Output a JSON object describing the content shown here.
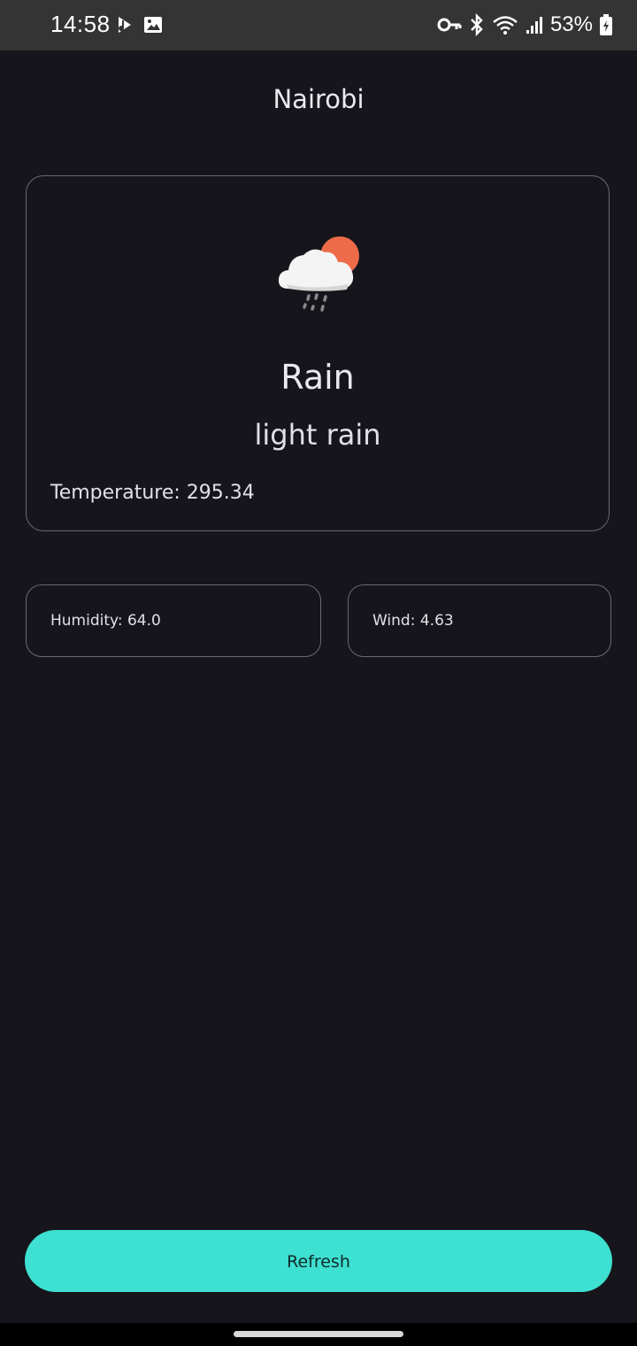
{
  "status_bar": {
    "time": "14:58",
    "left_icons": [
      "youtube-music-icon",
      "gallery-icon"
    ],
    "right_icons": [
      "vpn-key-icon",
      "bluetooth-icon",
      "wifi-icon",
      "signal-icon",
      "battery-charging-icon"
    ],
    "battery": "53%"
  },
  "city": "Nairobi",
  "weather": {
    "icon": "rain-cloud-sun-icon",
    "condition": "Rain",
    "description": "light rain",
    "temperature_label": "Temperature: 295.34"
  },
  "details": {
    "humidity_label": "Humidity: 64.0",
    "wind_label": "Wind: 4.63"
  },
  "refresh_button": {
    "label": "Refresh"
  },
  "colors": {
    "background": "#16151b",
    "status_bar": "#343434",
    "card_border": "#6a6870",
    "accent": "#3ee0d1",
    "sun": "#ee6b4a",
    "cloud": "#f4f4f4"
  }
}
